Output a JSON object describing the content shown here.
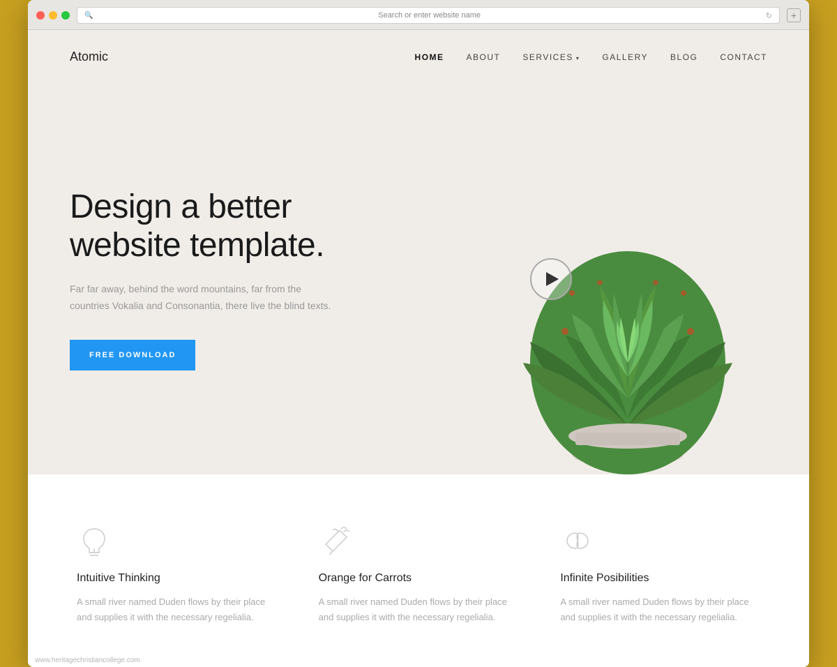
{
  "browser": {
    "address_placeholder": "Search or enter website name"
  },
  "nav": {
    "logo": "Atomic",
    "links": [
      {
        "id": "home",
        "label": "HOME",
        "active": true,
        "has_dropdown": false
      },
      {
        "id": "about",
        "label": "ABOUT",
        "active": false,
        "has_dropdown": false
      },
      {
        "id": "services",
        "label": "SERVICES",
        "active": false,
        "has_dropdown": true
      },
      {
        "id": "gallery",
        "label": "GALLERY",
        "active": false,
        "has_dropdown": false
      },
      {
        "id": "blog",
        "label": "BLOG",
        "active": false,
        "has_dropdown": false
      },
      {
        "id": "contact",
        "label": "CONTACT",
        "active": false,
        "has_dropdown": false
      }
    ]
  },
  "hero": {
    "title": "Design a better website template.",
    "subtitle": "Far far away, behind the word mountains, far from the countries Vokalia and Consonantia, there live the blind texts.",
    "cta_label": "FREE DOWNLOAD"
  },
  "features": [
    {
      "id": "intuitive-thinking",
      "icon": "lightbulb",
      "title": "Intuitive Thinking",
      "text": "A small river named Duden flows by their place and supplies it with the necessary regelialia."
    },
    {
      "id": "orange-for-carrots",
      "icon": "carrot",
      "title": "Orange for Carrots",
      "text": "A small river named Duden flows by their place and supplies it with the necessary regelialia."
    },
    {
      "id": "infinite-possibilities",
      "icon": "infinity",
      "title": "Infinite Posibilities",
      "text": "A small river named Duden flows by their place and supplies it with the necessary regelialia."
    }
  ],
  "watermark": "www.heritagechristiancollege.com",
  "accent_color": "#2196f3"
}
